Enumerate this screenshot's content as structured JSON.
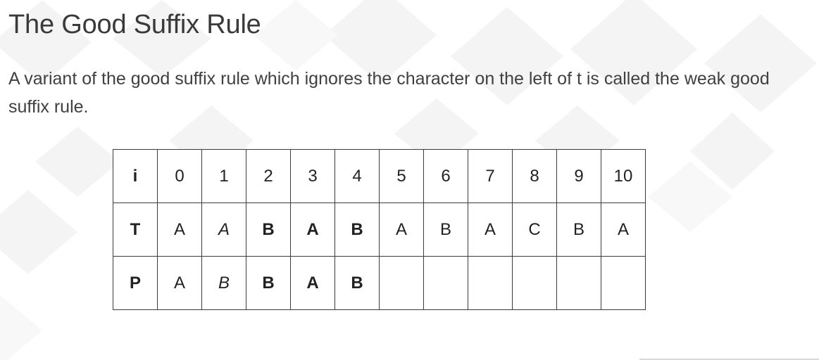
{
  "slide": {
    "title": "The Good Suffix Rule",
    "body": "A variant of the good suffix rule which ignores the character on the left of t is called the weak good suffix rule."
  },
  "table": {
    "rows": [
      {
        "header": "i",
        "cells": [
          "0",
          "1",
          "2",
          "3",
          "4",
          "5",
          "6",
          "7",
          "8",
          "9",
          "10"
        ],
        "styles": [
          "",
          "",
          "",
          "",
          "",
          "",
          "",
          "",
          "",
          "",
          ""
        ]
      },
      {
        "header": "T",
        "cells": [
          "A",
          "A",
          "B",
          "A",
          "B",
          "A",
          "B",
          "A",
          "C",
          "B",
          "A"
        ],
        "styles": [
          "",
          "i",
          "b",
          "b",
          "b",
          "",
          "",
          "",
          "",
          "",
          ""
        ]
      },
      {
        "header": "P",
        "cells": [
          "A",
          "B",
          "B",
          "A",
          "B",
          "",
          "",
          "",
          "",
          "",
          ""
        ],
        "styles": [
          "",
          "i",
          "b",
          "b",
          "b",
          "",
          "",
          "",
          "",
          "",
          ""
        ]
      }
    ]
  },
  "colors": {
    "background": "#ffffff",
    "pattern": "#f3f3f3",
    "text": "#404040",
    "border": "#3c3c3c"
  }
}
